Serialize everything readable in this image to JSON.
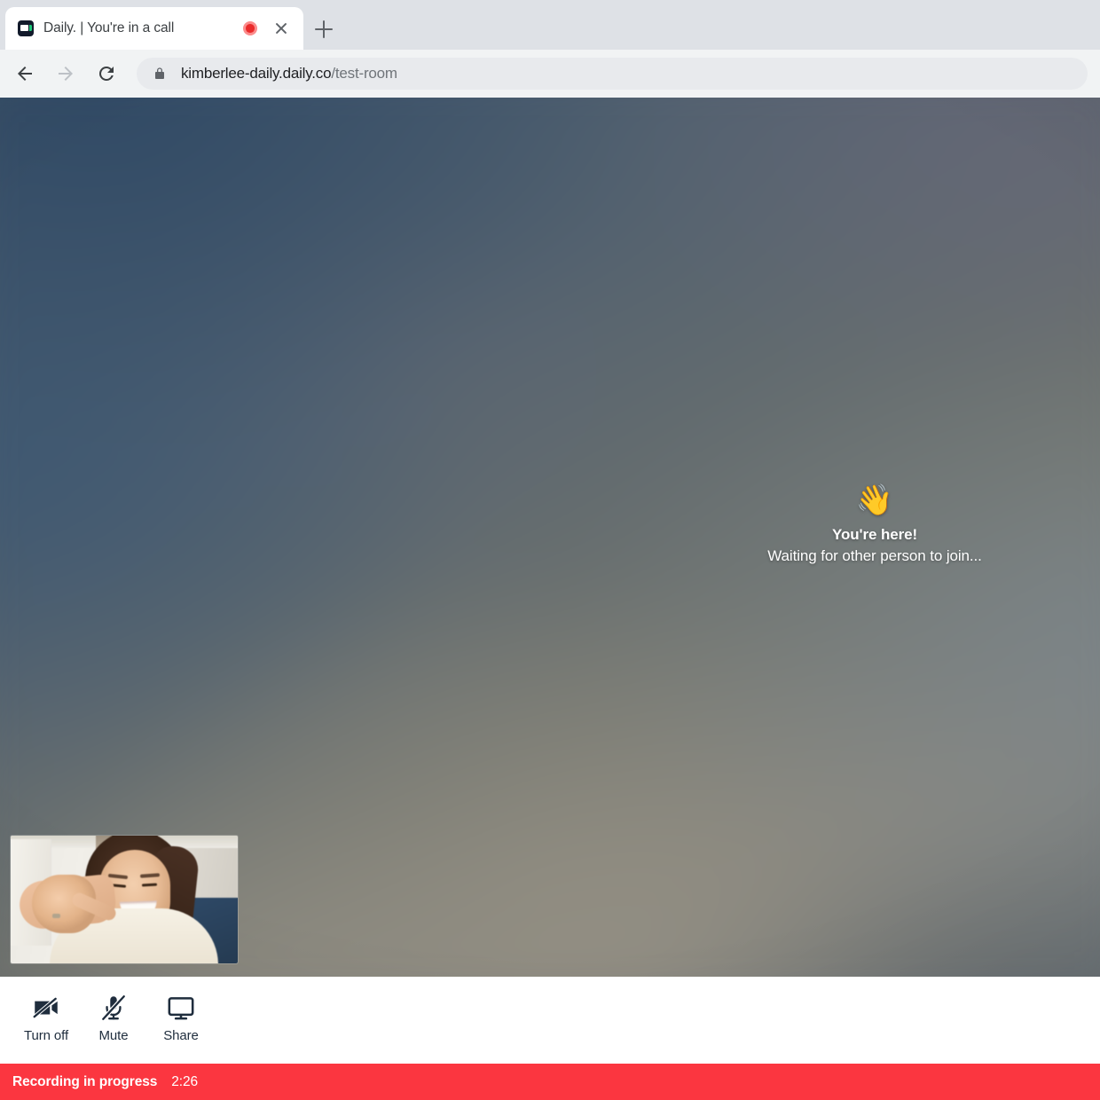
{
  "browser": {
    "tab": {
      "favicon_name": "daily-camera-favicon",
      "title": "Daily. | You're in a call",
      "recording_indicator": "recording-dot-icon",
      "close_label": "close-tab-icon"
    },
    "new_tab_label": "new-tab-icon",
    "nav": {
      "back": "back-arrow-icon",
      "forward": "forward-arrow-icon",
      "reload": "reload-icon"
    },
    "omnibox": {
      "lock": "lock-icon",
      "url_host": "kimberlee-daily.daily.co",
      "url_path": "/test-room",
      "full_url": "kimberlee-daily.daily.co/test-room"
    }
  },
  "call": {
    "waiting": {
      "emoji": "👋",
      "title": "You're here!",
      "subtitle": "Waiting for other person to join..."
    },
    "self_view": {
      "label": "self-view-video"
    }
  },
  "controls": [
    {
      "icon": "camera-off-icon",
      "label": "Turn off"
    },
    {
      "icon": "mic-off-icon",
      "label": "Mute"
    },
    {
      "icon": "screen-share-icon",
      "label": "Share"
    }
  ],
  "recording": {
    "label": "Recording in progress",
    "timer": "2:26",
    "color": "#fb3640"
  },
  "colors": {
    "chrome_tabstrip": "#dee1e6",
    "chrome_toolbar": "#f1f3f4",
    "omnibox": "#e8eaed",
    "recording_red": "#fb3640",
    "control_text": "#1f2d3d",
    "stage_blue": "#42586f",
    "stage_warm": "#8a8880"
  }
}
